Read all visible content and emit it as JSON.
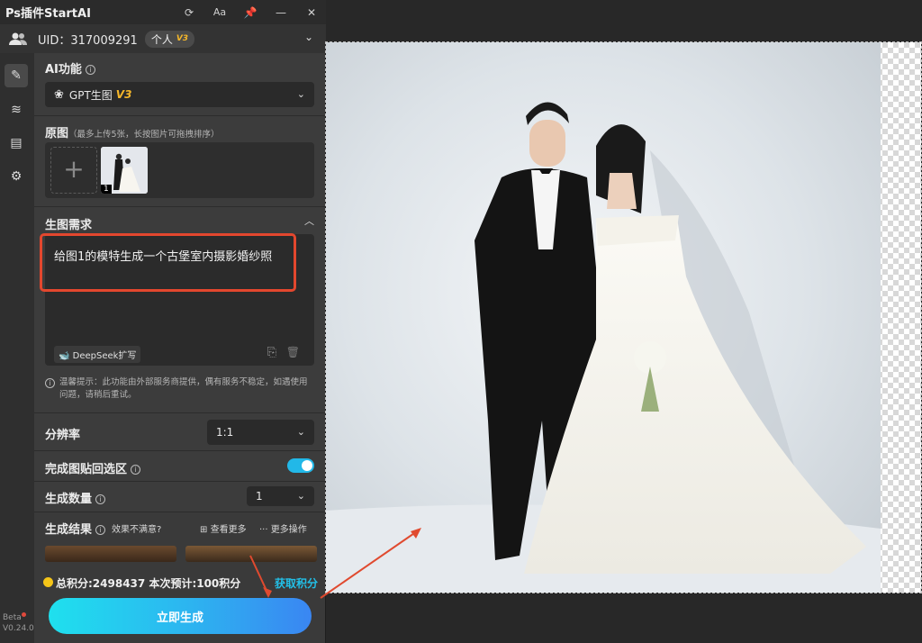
{
  "app": {
    "title": "Ps插件StartAI"
  },
  "titlebar": {
    "icons": [
      "refresh-icon",
      "font-size-icon",
      "pin-icon",
      "minimize-icon",
      "close-icon"
    ]
  },
  "user": {
    "uid_text": "UID：317009291",
    "plan": "个人",
    "plan_version": "V3"
  },
  "ai_function": {
    "label": "AI功能",
    "selected": "GPT生图",
    "version": "V3"
  },
  "source": {
    "label": "原图",
    "hint": "（最多上传5张，长按图片可拖拽排序）",
    "thumb_index": "1"
  },
  "prompt": {
    "label": "生图需求",
    "text": "给图1的模特生成一个古堡室内摄影婚纱照",
    "deepseek_label": "DeepSeek扩写",
    "tip": "温馨提示：此功能由外部服务商提供，偶有服务不稳定，如遇使用问题，请稍后重试。"
  },
  "resolution": {
    "label": "分辨率",
    "value": "1:1"
  },
  "paste_back": {
    "label": "完成图贴回选区",
    "enabled": true
  },
  "quantity": {
    "label": "生成数量",
    "value": "1"
  },
  "results": {
    "label": "生成结果",
    "unsatisfied": "效果不满意?",
    "view_more": "查看更多",
    "more_actions": "更多操作"
  },
  "points": {
    "total": "总积分:2498437",
    "estimate": "本次预计:100积分",
    "get": "获取积分"
  },
  "generate_button": "立即生成",
  "version": {
    "beta": "Beta",
    "number": "V0.24.0"
  },
  "colors": {
    "accent": "#22b8e8",
    "highlight": "#e3472e",
    "coin": "#f5c518",
    "v3": "#f5b72a"
  }
}
